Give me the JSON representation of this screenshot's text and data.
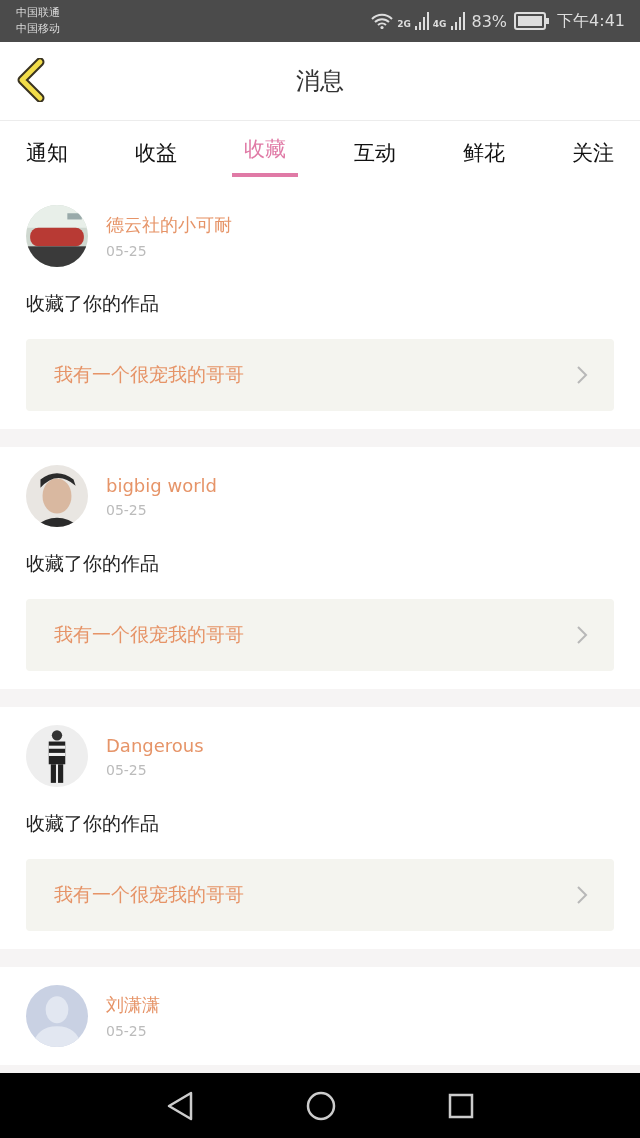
{
  "status_bar": {
    "carriers": [
      "中国联通",
      "中国移动"
    ],
    "network_1": "2G",
    "network_2": "4G",
    "battery": "83%",
    "time": "下午4:41"
  },
  "header": {
    "title": "消息"
  },
  "tabs": [
    {
      "label": "通知",
      "selected": false
    },
    {
      "label": "收益",
      "selected": false
    },
    {
      "label": "收藏",
      "selected": true
    },
    {
      "label": "互动",
      "selected": false
    },
    {
      "label": "鲜花",
      "selected": false
    },
    {
      "label": "关注",
      "selected": false
    }
  ],
  "items": [
    {
      "name": "德云社的小可耐",
      "date": "05-25",
      "action": "收藏了你的作品",
      "work": "我有一个很宠我的哥哥"
    },
    {
      "name": "bigbig world",
      "date": "05-25",
      "action": "收藏了你的作品",
      "work": "我有一个很宠我的哥哥"
    },
    {
      "name": "Dangerous",
      "date": "05-25",
      "action": "收藏了你的作品",
      "work": "我有一个很宠我的哥哥"
    },
    {
      "avatar": {
        "kind": "default"
      },
      "name": "刘潇潇",
      "date": "05-25"
    }
  ]
}
